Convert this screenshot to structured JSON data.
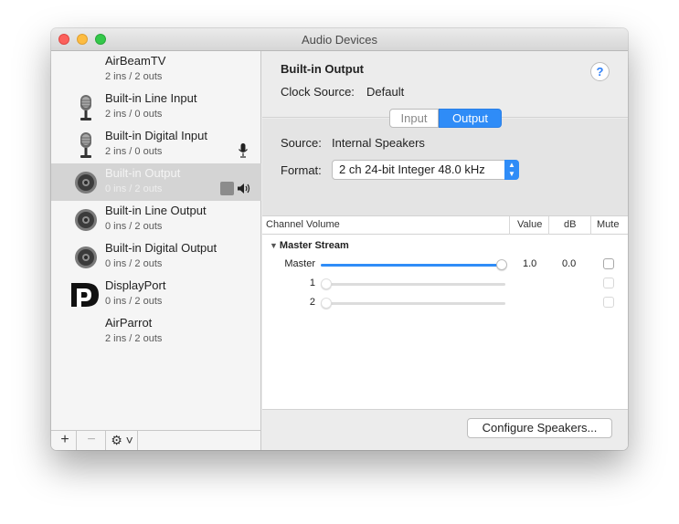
{
  "window": {
    "title": "Audio Devices"
  },
  "devices": [
    {
      "name": "AirBeamTV",
      "io": "2 ins / 2 outs",
      "icon": "none"
    },
    {
      "name": "Built-in Line Input",
      "io": "2 ins / 0 outs",
      "icon": "microphone-icon"
    },
    {
      "name": "Built-in Digital Input",
      "io": "2 ins / 0 outs",
      "icon": "microphone-icon"
    },
    {
      "name": "Built-in Output",
      "io": "0 ins / 2 outs",
      "icon": "speaker-icon",
      "selected": true
    },
    {
      "name": "Built-in Line Output",
      "io": "0 ins / 2 outs",
      "icon": "speaker-icon"
    },
    {
      "name": "Built-in Digital Output",
      "io": "0 ins / 2 outs",
      "icon": "speaker-icon"
    },
    {
      "name": "DisplayPort",
      "io": "0 ins / 2 outs",
      "icon": "displayport-icon"
    },
    {
      "name": "AirParrot",
      "io": "2 ins / 2 outs",
      "icon": "none"
    }
  ],
  "sidebar_toolbar": {
    "add": "+",
    "remove": "−",
    "gear": "⚙ ˅"
  },
  "detail": {
    "title": "Built-in Output",
    "clock_source_label": "Clock Source:",
    "clock_source_value": "Default",
    "help": "?",
    "tabs": {
      "input": "Input",
      "output": "Output",
      "selected": "Output"
    },
    "source_label": "Source:",
    "source_value": "Internal Speakers",
    "format_label": "Format:",
    "format_value": "2 ch 24-bit Integer 48.0 kHz"
  },
  "table": {
    "headers": {
      "channel": "Channel Volume",
      "value": "Value",
      "db": "dB",
      "mute": "Mute"
    },
    "group": "Master Stream",
    "rows": [
      {
        "label": "Master",
        "value": "1.0",
        "db": "0.0",
        "level": 1.0,
        "enabled": true
      },
      {
        "label": "1",
        "value": "",
        "db": "",
        "level": 0.0,
        "enabled": false
      },
      {
        "label": "2",
        "value": "",
        "db": "",
        "level": 0.0,
        "enabled": false
      }
    ]
  },
  "configure_button": "Configure Speakers...",
  "colors": {
    "accent": "#2f8cf7",
    "selection": "#d4d4d4"
  }
}
